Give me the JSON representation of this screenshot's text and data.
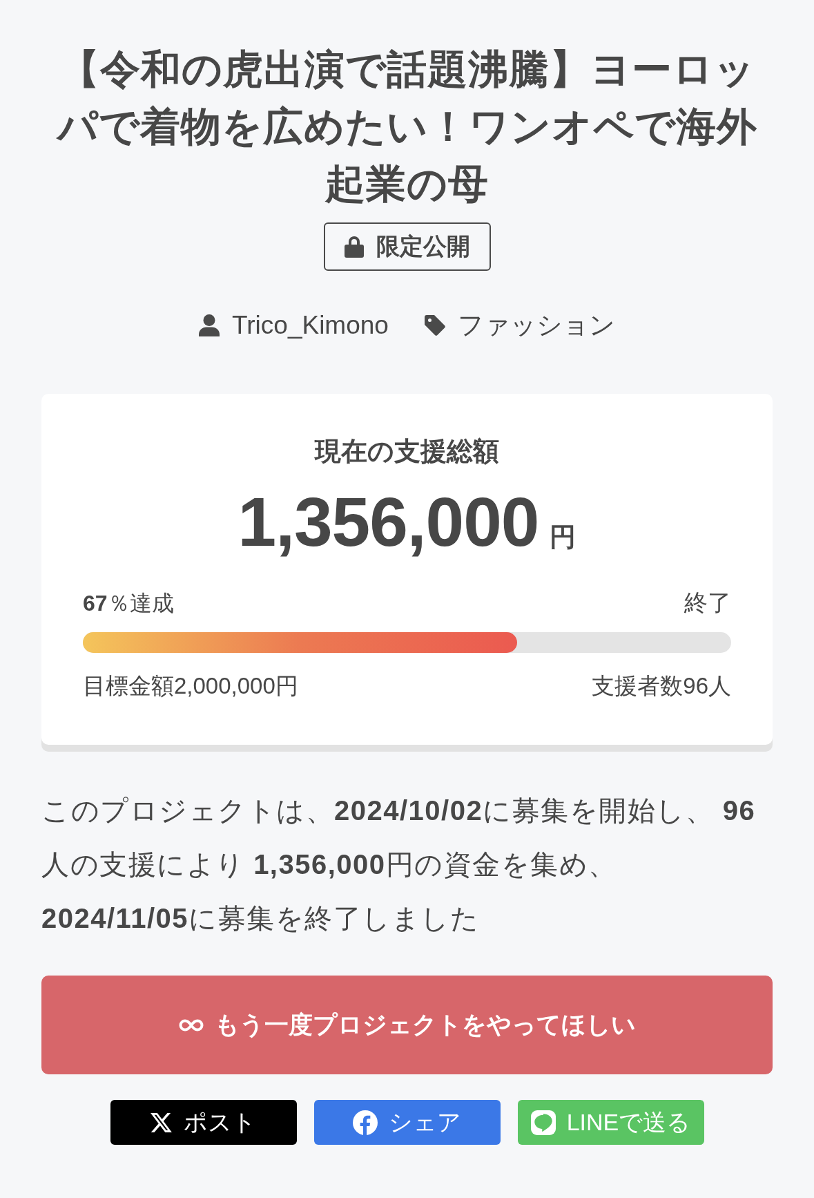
{
  "title": "【令和の虎出演で話題沸騰】ヨーロッパで着物を広めたい！ワンオペで海外起業の母",
  "badge": {
    "label": "限定公開"
  },
  "meta": {
    "author": "Trico_Kimono",
    "category": "ファッション"
  },
  "funding": {
    "heading": "現在の支援総額",
    "amount": "1,356,000",
    "currency": "円",
    "achievement": "**67**％達成",
    "status": "終了",
    "progress": {
      "level": 0.67
    },
    "goal": "目標金額2,000,000円",
    "supporters": "支援者数96人"
  },
  "summary": "このプロジェクトは、**2024/10/02**に募集を開始し、 **96**人の支援により **1,356,000**円の資金を集め、 **2024/11/05**に募集を終了しました",
  "encore_button": {
    "label": "もう一度プロジェクトをやってほしい"
  },
  "share_buttons": [
    {
      "kind": "x",
      "label": "ポスト"
    },
    {
      "kind": "facebook",
      "label": "シェア"
    },
    {
      "kind": "line",
      "label": "LINEで送る"
    }
  ]
}
